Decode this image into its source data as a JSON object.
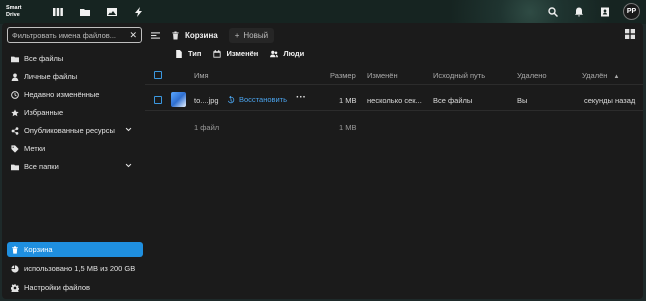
{
  "app": {
    "logo_line1": "Smart",
    "logo_line2": "Drive"
  },
  "topbar": {
    "left_icons": [
      "dashboard-icon",
      "folder-icon",
      "photos-icon",
      "activity-icon"
    ],
    "right_icons": [
      "search-icon",
      "notifications-icon",
      "contacts-icon"
    ],
    "avatar_initials": "PP"
  },
  "sidebar": {
    "filter_placeholder": "Фильтровать имена файлов...",
    "items": [
      {
        "label": "Все файлы",
        "icon": "folder-icon"
      },
      {
        "label": "Личные файлы",
        "icon": "user-icon"
      },
      {
        "label": "Недавно изменённые",
        "icon": "clock-icon"
      },
      {
        "label": "Избранные",
        "icon": "star-icon"
      },
      {
        "label": "Опубликованные ресурсы",
        "icon": "share-icon"
      },
      {
        "label": "Метки",
        "icon": "tag-icon"
      },
      {
        "label": "Все папки",
        "icon": "folder-icon"
      }
    ],
    "trash_label": "Корзина",
    "quota_label": "использовано 1,5 MB из 200 GB",
    "settings_label": "Настройки файлов"
  },
  "main": {
    "breadcrumb_title": "Корзина",
    "new_label": "Новый",
    "filters": [
      {
        "label": "Тип",
        "icon": "file-icon"
      },
      {
        "label": "Изменён",
        "icon": "calendar-icon"
      },
      {
        "label": "Люди",
        "icon": "people-icon"
      }
    ],
    "columns": {
      "name": "Имя",
      "size": "Размер",
      "modified": "Изменён",
      "original_path": "Исходный путь",
      "deleted_by": "Удалено",
      "deleted": "Удалён"
    },
    "rows": [
      {
        "name": "to....jpg",
        "restore_label": "Восстановить",
        "size": "1 MB",
        "modified": "несколько сек...",
        "original_path": "Все файлы",
        "deleted_by": "Вы",
        "deleted": "секунды назад"
      }
    ],
    "summary": {
      "count": "1 файл",
      "size": "1 MB"
    }
  },
  "colors": {
    "accent": "#1f8fdf",
    "link": "#4aa3ec",
    "background": "#1b1b1b"
  }
}
